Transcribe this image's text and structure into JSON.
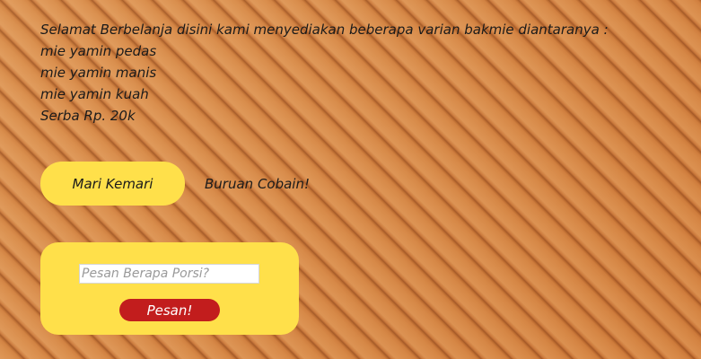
{
  "intro": {
    "heading": "Selamat Berbelanja disini kami menyediakan beberapa varian bakmie diantaranya :",
    "items": [
      "mie yamin pedas",
      "mie yamin manis",
      "mie yamin kuah"
    ],
    "price": "Serba Rp. 20k"
  },
  "cta": {
    "button_label": "Mari Kemari",
    "tagline": "Buruan Cobain!"
  },
  "order": {
    "input_value": "",
    "input_placeholder": "Pesan Berapa Porsi?",
    "submit_label": "Pesan!"
  },
  "colors": {
    "accent_yellow": "#ffe04a",
    "button_red": "#c21d1d",
    "background": "bamboo-mat"
  }
}
